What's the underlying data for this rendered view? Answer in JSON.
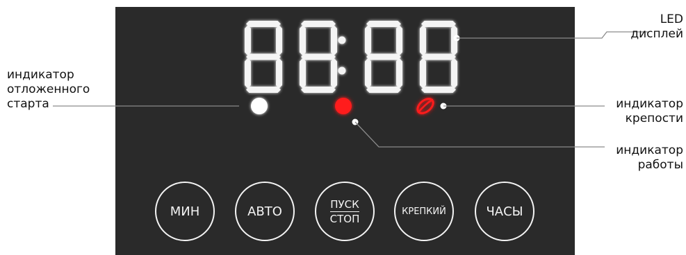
{
  "display": {
    "digits": [
      "8",
      "8",
      "8",
      "8"
    ],
    "separator": ":",
    "led_color": "#f4f4f4",
    "glow_color": "#ffffff"
  },
  "indicators": {
    "delayed_start": {
      "color": "#ffffff"
    },
    "work": {
      "color": "#ff1a1a"
    },
    "strength": {
      "color": "#ff1a1a",
      "icon": "coffee-bean-icon"
    }
  },
  "buttons": {
    "min": {
      "label": "МИН"
    },
    "auto": {
      "label": "АВТО"
    },
    "start_stop": {
      "label_top": "ПУСК",
      "label_bottom": "СТОП"
    },
    "strong": {
      "label": "КРЕПКИЙ"
    },
    "hours": {
      "label": "ЧАСЫ"
    }
  },
  "callouts": {
    "led_display": "LED\nдисплей",
    "delayed_start": "индикатор\nотложенного\nстарта",
    "strength": "индикатор\nкрепости",
    "work": "индикатор\nработы"
  },
  "colors": {
    "panel": "#2a2a2a",
    "leader_line": "#8a8a8a",
    "label_text": "#111111"
  }
}
